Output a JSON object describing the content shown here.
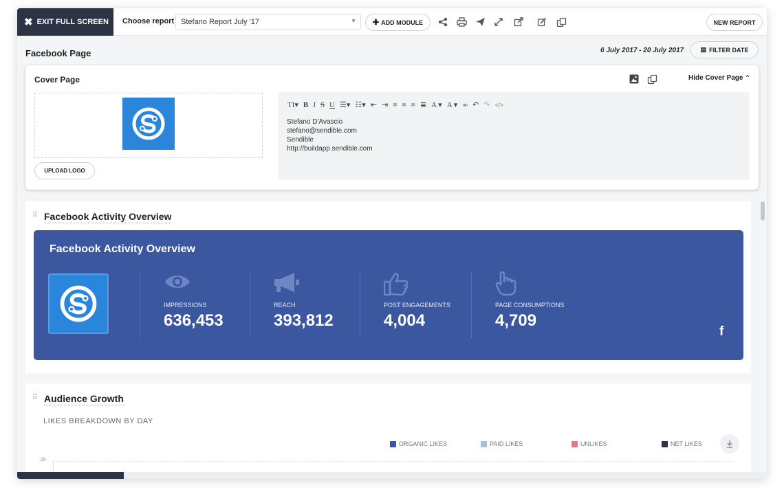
{
  "toolbar": {
    "exit_label": "EXIT FULL SCREEN",
    "choose_report_label": "Choose report",
    "report_selected": "Stefano Report July '17",
    "add_module_label": "ADD MODULE",
    "new_report_label": "NEW REPORT",
    "icons": [
      "share-icon",
      "print-icon",
      "send-icon",
      "expand-icon",
      "external-link-icon",
      "edit-icon",
      "duplicate-icon"
    ]
  },
  "header": {
    "page_title": "Facebook Page",
    "date_range": "6 July 2017 - 20 July 2017",
    "filter_date_label": "FILTER DATE"
  },
  "cover": {
    "title": "Cover Page",
    "hide_label": "Hide Cover Page",
    "upload_logo_label": "UPLOAD LOGO",
    "editor_lines": [
      "Stefano D'Avascio",
      "stefano@sendible.com",
      "Sendible",
      "http://buildapp.sendible.com"
    ]
  },
  "activity": {
    "section_title": "Facebook Activity Overview",
    "card_title": "Facebook Activity Overview",
    "metrics": [
      {
        "label": "IMPRESSIONS",
        "value": "636,453",
        "icon": "eye-icon"
      },
      {
        "label": "REACH",
        "value": "393,812",
        "icon": "megaphone-icon"
      },
      {
        "label": "POST ENGAGEMENTS",
        "value": "4,004",
        "icon": "thumbs-up-icon"
      },
      {
        "label": "PAGE CONSUMPTIONS",
        "value": "4,709",
        "icon": "pointer-hand-icon"
      }
    ],
    "network_icon": "facebook-icon",
    "network_glyph": "f"
  },
  "audience": {
    "section_title": "Audience Growth",
    "subtitle": "LIKES BREAKDOWN BY DAY",
    "legend": [
      {
        "label": "ORGANIC LIKES",
        "color": "#3b57a0"
      },
      {
        "label": "PAID LIKES",
        "color": "#a9bfe0"
      },
      {
        "label": "UNLIKES",
        "color": "#e07a86"
      },
      {
        "label": "NET LIKES",
        "color": "#2b3345"
      }
    ],
    "y_tick_top": "25"
  },
  "colors": {
    "dark": "#2b3345",
    "facebook_blue": "#3b57a0",
    "brand_blue": "#2a86db"
  }
}
